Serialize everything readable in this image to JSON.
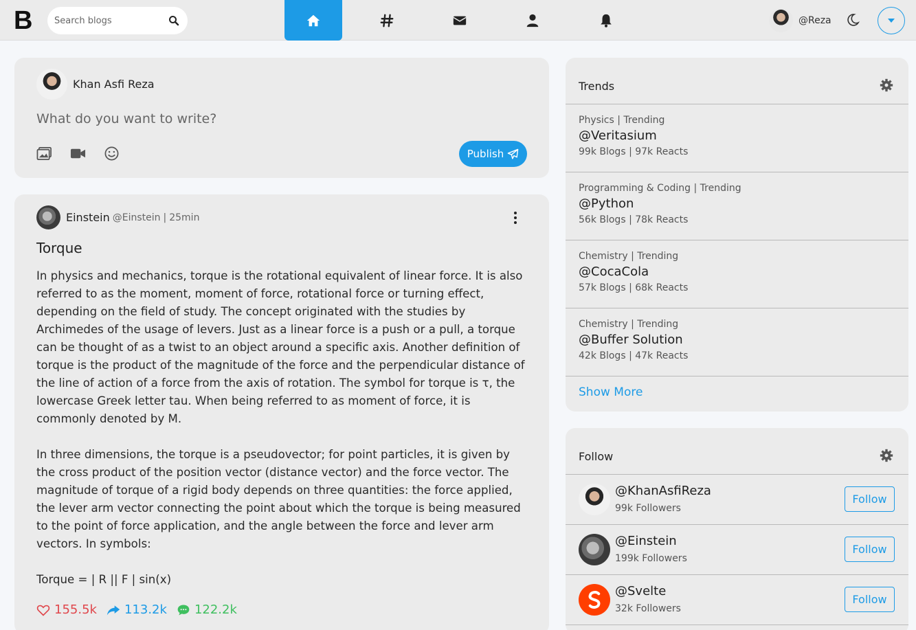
{
  "brand": {
    "logo": "B"
  },
  "search": {
    "placeholder": "Search blogs"
  },
  "nav": {
    "items": [
      {
        "name": "home",
        "icon": "home-icon",
        "active": true
      },
      {
        "name": "hashtag",
        "icon": "hashtag-icon",
        "active": false
      },
      {
        "name": "messages",
        "icon": "envelope-icon",
        "active": false
      },
      {
        "name": "profile",
        "icon": "user-icon",
        "active": false
      },
      {
        "name": "notifications",
        "icon": "bell-icon",
        "active": false
      }
    ]
  },
  "user": {
    "handle": "@Reza"
  },
  "composer": {
    "author": "Khan Asfi Reza",
    "prompt": "What do you want to write?",
    "publish_label": "Publish"
  },
  "post": {
    "author": "Einstein",
    "handle": "@Einstein",
    "time": "25min",
    "title": "Torque",
    "body": "In physics and mechanics, torque is the rotational equivalent of linear force. It is also referred to as the moment, moment of force, rotational force or turning effect, depending on the field of study. The concept originated with the studies by Archimedes of the usage of levers. Just as a linear force is a push or a pull, a torque can be thought of as a twist to an object around a specific axis. Another definition of torque is the product of the magnitude of the force and the perpendicular distance of the line of action of a force from the axis of rotation. The symbol for torque is τ, the lowercase Greek letter tau. When being referred to as moment of force, it is commonly denoted by M.\n\nIn three dimensions, the torque is a pseudovector; for point particles, it is given by the cross product of the position vector (distance vector) and the force vector. The magnitude of torque of a rigid body depends on three quantities: the force applied, the lever arm vector connecting the point about which the torque is being measured to the point of force application, and the angle between the force and lever arm vectors. In symbols:\n\nTorque = | R || F | sin(x)",
    "likes": "155.5k",
    "shares": "113.2k",
    "comments": "122.2k"
  },
  "trends": {
    "title": "Trends",
    "items": [
      {
        "category": "Physics | Trending",
        "tag": "@Veritasium",
        "counts": "99k Blogs | 97k Reacts"
      },
      {
        "category": "Programming & Coding | Trending",
        "tag": "@Python",
        "counts": "56k Blogs | 78k Reacts"
      },
      {
        "category": "Chemistry | Trending",
        "tag": "@CocaCola",
        "counts": "57k Blogs | 68k Reacts"
      },
      {
        "category": "Chemistry | Trending",
        "tag": "@Buffer Solution",
        "counts": "42k Blogs | 47k Reacts"
      }
    ],
    "show_more": "Show More"
  },
  "follow": {
    "title": "Follow",
    "button_label": "Follow",
    "items": [
      {
        "handle": "@KhanAsfiReza",
        "followers": "99k Followers"
      },
      {
        "handle": "@Einstein",
        "followers": "199k Followers"
      },
      {
        "handle": "@Svelte",
        "followers": "32k Followers"
      }
    ]
  },
  "colors": {
    "accent": "#1d9be6",
    "like": "#e0474c",
    "share": "#1d9be6",
    "comment": "#3fbf5f",
    "card": "#ebebeb",
    "page": "#f5f7fa"
  }
}
